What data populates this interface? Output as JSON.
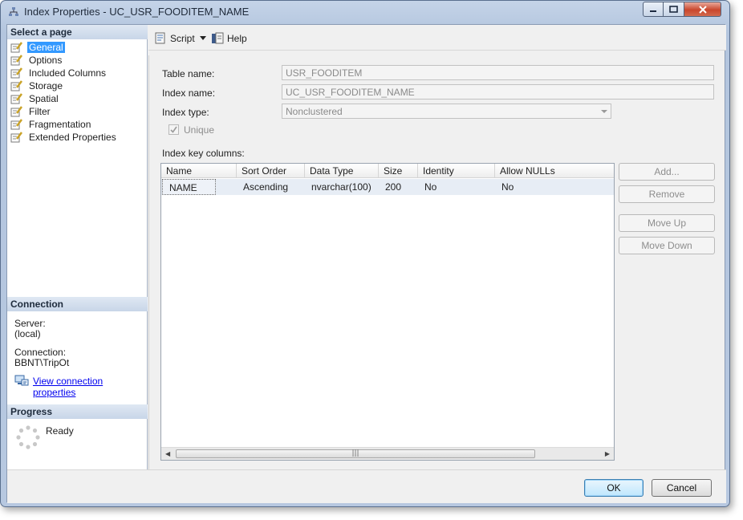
{
  "window": {
    "title": "Index Properties - UC_USR_FOODITEM_NAME"
  },
  "left": {
    "select_header": "Select a page",
    "pages": [
      "General",
      "Options",
      "Included Columns",
      "Storage",
      "Spatial",
      "Filter",
      "Fragmentation",
      "Extended Properties"
    ],
    "selected_page": "General",
    "connection_header": "Connection",
    "server_label": "Server:",
    "server_value": "(local)",
    "connection_label": "Connection:",
    "connection_value": "BBNT\\TripOt",
    "view_link": "View connection properties",
    "progress_header": "Progress",
    "progress_status": "Ready"
  },
  "toolbar": {
    "script_label": "Script",
    "help_label": "Help"
  },
  "general": {
    "table_name_label": "Table name:",
    "table_name_value": "USR_FOODITEM",
    "index_name_label": "Index name:",
    "index_name_value": "UC_USR_FOODITEM_NAME",
    "index_type_label": "Index type:",
    "index_type_value": "Nonclustered",
    "unique_label": "Unique",
    "unique_checked": true,
    "key_columns_label": "Index key columns:"
  },
  "grid": {
    "headers": [
      "Name",
      "Sort Order",
      "Data Type",
      "Size",
      "Identity",
      "Allow NULLs"
    ],
    "rows": [
      [
        "NAME",
        "Ascending",
        "nvarchar(100)",
        "200",
        "No",
        "No"
      ]
    ]
  },
  "side_buttons": [
    "Add...",
    "Remove",
    "Move Up",
    "Move Down"
  ],
  "dialog": {
    "ok": "OK",
    "cancel": "Cancel"
  },
  "colors": {
    "selection": "#3399ff",
    "link": "#0000ee",
    "header_bg": "#c8d6e8"
  }
}
